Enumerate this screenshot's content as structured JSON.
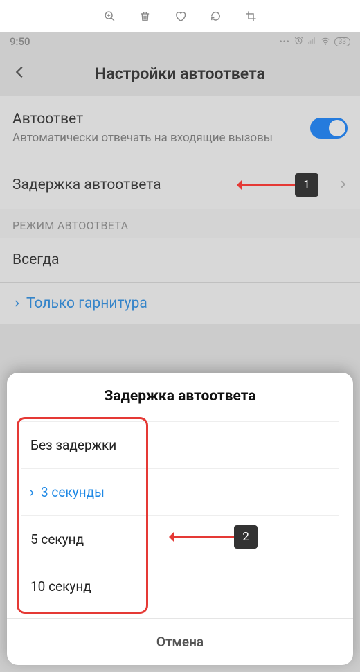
{
  "toolbar_icons": [
    "zoom-in",
    "trash",
    "heart",
    "rotate",
    "crop"
  ],
  "status": {
    "time": "9:50",
    "battery": "33"
  },
  "header": {
    "title": "Настройки автоответа"
  },
  "rows": {
    "autoanswer": {
      "title": "Автоответ",
      "sub": "Автоматически отвечать на входящие вызовы",
      "enabled": true
    },
    "delay": {
      "title": "Задержка автоответа"
    },
    "section_label": "РЕЖИМ АВТООТВЕТА",
    "always": {
      "title": "Всегда"
    },
    "headset": {
      "title": "Только гарнитура"
    }
  },
  "annotations": {
    "one": "1",
    "two": "2"
  },
  "sheet": {
    "title": "Задержка автоответа",
    "options": [
      {
        "label": "Без задержки",
        "selected": false
      },
      {
        "label": "3 секунды",
        "selected": true
      },
      {
        "label": "5 секунд",
        "selected": false
      },
      {
        "label": "10 секунд",
        "selected": false
      }
    ],
    "cancel": "Отмена"
  },
  "colors": {
    "accent": "#1e88e5",
    "toggle": "#0a7cff",
    "annot": "#e53935"
  }
}
